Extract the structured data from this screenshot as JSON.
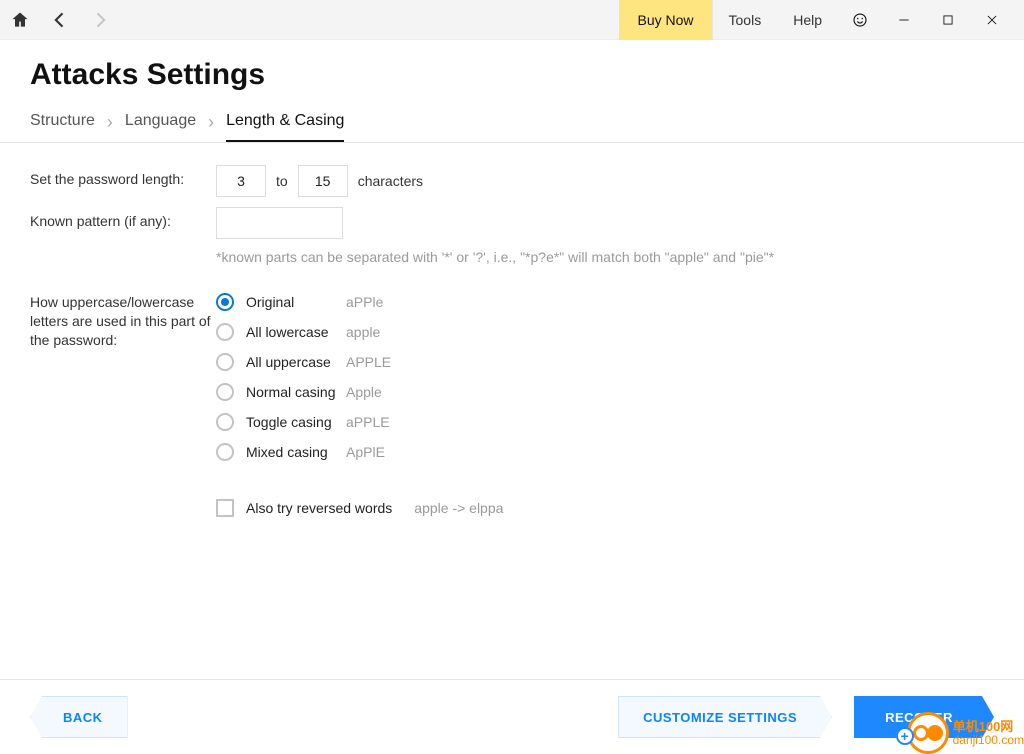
{
  "topbar": {
    "buy_now": "Buy Now",
    "tools": "Tools",
    "help": "Help"
  },
  "page_title": "Attacks Settings",
  "tabs": {
    "structure": "Structure",
    "language": "Language",
    "length_casing": "Length & Casing"
  },
  "length": {
    "label": "Set the password length:",
    "min": "3",
    "to": "to",
    "max": "15",
    "characters": "characters"
  },
  "pattern": {
    "label": "Known pattern (if any):",
    "value": "",
    "hint": "*known parts can be separated with '*' or '?', i.e., \"*p?e*\" will match both \"apple\" and \"pie\"*"
  },
  "casing": {
    "label": "How uppercase/lowercase letters are used in this part of the password:",
    "options": [
      {
        "label": "Original",
        "example": "aPPle",
        "selected": true
      },
      {
        "label": "All lowercase",
        "example": "apple",
        "selected": false
      },
      {
        "label": "All uppercase",
        "example": "APPLE",
        "selected": false
      },
      {
        "label": "Normal casing",
        "example": "Apple",
        "selected": false
      },
      {
        "label": "Toggle casing",
        "example": "aPPLE",
        "selected": false
      },
      {
        "label": "Mixed casing",
        "example": "ApPlE",
        "selected": false
      }
    ]
  },
  "reversed": {
    "label": "Also try reversed words",
    "example": "apple -> elppa",
    "checked": false
  },
  "footer": {
    "back": "BACK",
    "customize": "CUSTOMIZE SETTINGS",
    "recover": "RECOVER"
  },
  "watermark": {
    "line1": "单机100网",
    "line2": "danji100.com"
  }
}
